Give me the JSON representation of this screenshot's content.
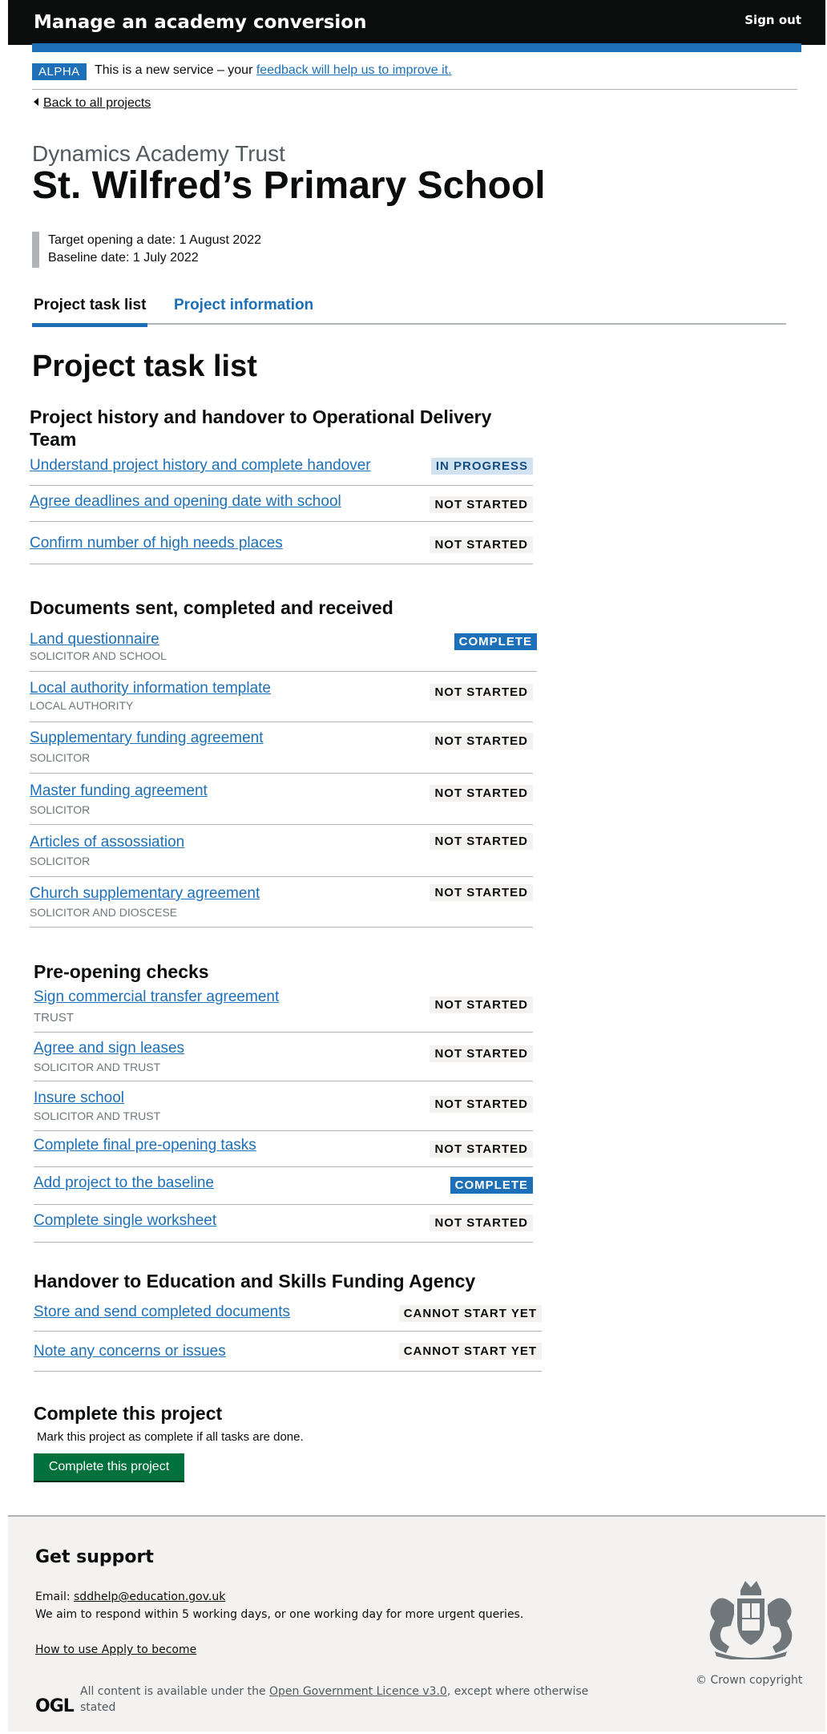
{
  "header": {
    "service_name": "Manage an academy conversion",
    "sign_out": "Sign out"
  },
  "phase": {
    "tag": "ALPHA",
    "text": "This is a new service – your",
    "link": "feedback will help us to improve it."
  },
  "back_link": "Back to all projects",
  "trust_name": "Dynamics Academy Trust",
  "school_name": "St. Wilfred’s Primary School",
  "dates": {
    "target": "Target opening a date: 1 August 2022",
    "baseline": "Baseline date: 1 July 2022"
  },
  "tabs": [
    {
      "label": "Project task list"
    },
    {
      "label": "Project information"
    }
  ],
  "page_title": "Project task list",
  "sections": [
    {
      "title": "Project history and handover to Operational Delivery Team",
      "tasks": [
        {
          "name": "Understand project history and complete handover",
          "status": "IN PROGRESS"
        },
        {
          "name": "Agree deadlines and opening date with school",
          "status": "NOT STARTED"
        },
        {
          "name": "Confirm number of high needs places",
          "status": "NOT STARTED"
        }
      ]
    },
    {
      "title": "Documents sent, completed and received",
      "tasks": [
        {
          "name": "Land questionnaire",
          "sub": "SOLICITOR AND SCHOOL",
          "status": "COMPLETE"
        },
        {
          "name": "Local authority information template",
          "sub": "LOCAL AUTHORITY",
          "status": "NOT STARTED"
        },
        {
          "name": "Supplementary funding agreement",
          "sub": "SOLICITOR",
          "status": "NOT STARTED"
        },
        {
          "name": "Master funding agreement",
          "sub": "SOLICITOR",
          "status": "NOT STARTED"
        },
        {
          "name": "Articles of assossiation",
          "sub": "SOLICITOR",
          "status": "NOT STARTED"
        },
        {
          "name": "Church supplementary agreement",
          "sub": "SOLICITOR AND DIOSCESE",
          "status": "NOT STARTED"
        }
      ]
    },
    {
      "title": "Pre-opening checks",
      "tasks": [
        {
          "name": "Sign commercial transfer agreement",
          "sub": "TRUST",
          "status": "NOT STARTED"
        },
        {
          "name": "Agree and sign leases",
          "sub": "SOLICITOR AND TRUST",
          "status": "NOT STARTED"
        },
        {
          "name": "Insure school",
          "sub": "SOLICITOR AND TRUST",
          "status": "NOT STARTED"
        },
        {
          "name": "Complete final pre-opening tasks",
          "status": "NOT STARTED"
        },
        {
          "name": "Add project to the baseline",
          "status": "COMPLETE"
        },
        {
          "name": "Complete single worksheet",
          "status": "NOT STARTED"
        }
      ]
    },
    {
      "title": "Handover to Education and Skills Funding Agency",
      "tasks": [
        {
          "name": "Store and send completed documents",
          "status": "CANNOT START YET"
        },
        {
          "name": "Note any concerns or issues",
          "status": "CANNOT START YET"
        }
      ]
    }
  ],
  "complete": {
    "title": "Complete this project",
    "text": "Mark this project as complete if all tasks are done.",
    "button": "Complete this project"
  },
  "footer": {
    "title": "Get support",
    "email_label": "Email: ",
    "email": "sddhelp@education.gov.uk",
    "respond": "We aim to respond within 5 working days, or one working day for more urgent queries.",
    "how_to": "How to use Apply to become",
    "ogl": "OGL",
    "licence_prefix": "All content is available under the ",
    "licence_link": "Open Government Licence v3.0",
    "licence_suffix": ", except where otherwise stated",
    "copyright": "© Crown copyright"
  },
  "colors": {
    "brand_blue": "#1d70b8",
    "header_black": "#0b0c0c",
    "button_green": "#00703c",
    "footer_grey": "#f3f2f1"
  },
  "icons": [
    "back-arrow-icon",
    "royal-crest-icon"
  ]
}
